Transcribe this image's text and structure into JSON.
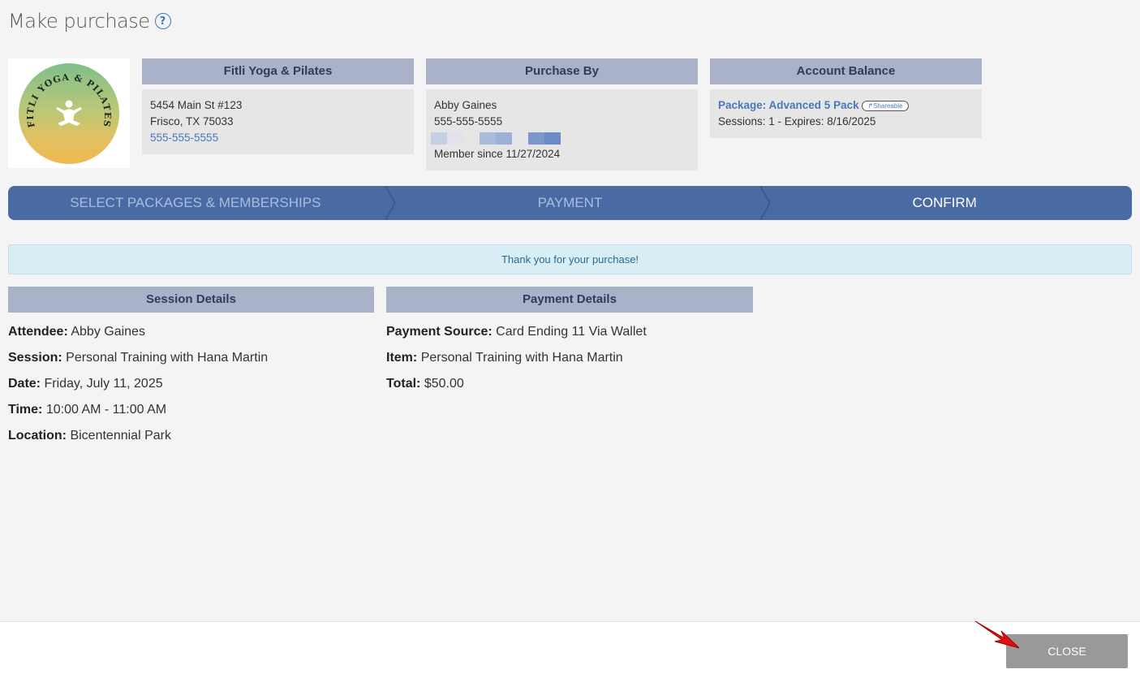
{
  "dialog": {
    "title": "Make purchase",
    "help_icon": "question-circle-icon"
  },
  "business": {
    "header": "Fitli Yoga & Pilates",
    "address_line1": "5454 Main St #123",
    "address_line2": "Frisco, TX 75033",
    "phone": "555-555-5555",
    "logo_text": "FITLI YOGA & PILATES"
  },
  "purchaser": {
    "header": "Purchase By",
    "name": "Abby Gaines",
    "phone": "555-555-5555",
    "member_since": "Member since 11/27/2024"
  },
  "balance": {
    "header": "Account Balance",
    "package_label": "Package: Advanced 5 Pack",
    "badge": "Shareable",
    "sessions": "Sessions: 1 -  Expires: 8/16/2025"
  },
  "steps": [
    {
      "label": "SELECT PACKAGES & MEMBERSHIPS"
    },
    {
      "label": "PAYMENT"
    },
    {
      "label": "CONFIRM"
    }
  ],
  "alert": "Thank you for your purchase!",
  "session_details": {
    "header": "Session Details",
    "rows": [
      {
        "label": "Attendee:",
        "value": "Abby Gaines"
      },
      {
        "label": "Session:",
        "value": "Personal Training with Hana Martin"
      },
      {
        "label": "Date:",
        "value": "Friday, July 11, 2025"
      },
      {
        "label": "Time:",
        "value": "10:00 AM - 11:00 AM"
      },
      {
        "label": "Location:",
        "value": "Bicentennial Park"
      }
    ]
  },
  "payment_details": {
    "header": "Payment Details",
    "rows": [
      {
        "label": "Payment Source:",
        "value": "Card Ending 11 Via Wallet"
      },
      {
        "label": "Item:",
        "value": "Personal Training with Hana Martin"
      },
      {
        "label": "Total:",
        "value": "$50.00"
      }
    ]
  },
  "footer": {
    "close_label": "CLOSE"
  },
  "colors": {
    "accent": "#4a6aa3",
    "header_bg": "#a9b2c9",
    "link": "#4a78b8",
    "alert_bg": "#d9edf5",
    "close_bg": "#999999",
    "arrow": "#e01010"
  }
}
